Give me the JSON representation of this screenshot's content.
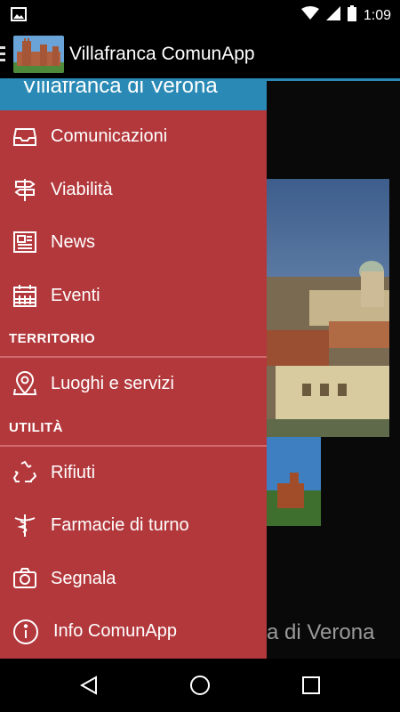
{
  "status_bar": {
    "time": "1:09",
    "icons": [
      "image-icon",
      "wifi-icon",
      "signal-icon",
      "battery-icon"
    ]
  },
  "action_bar": {
    "title": "Villafranca ComunApp",
    "logo": "castle-logo"
  },
  "drawer": {
    "header_title": "Villafranca di Verona",
    "items": [
      {
        "label": "Comunicazioni",
        "icon": "inbox-icon"
      },
      {
        "label": "Viabilità",
        "icon": "signpost-icon"
      },
      {
        "label": "News",
        "icon": "newspaper-icon"
      },
      {
        "label": "Eventi",
        "icon": "calendar-icon"
      }
    ],
    "territorio": {
      "header": "TERRITORIO",
      "items": [
        {
          "label": "Luoghi e servizi",
          "icon": "location-pin-icon"
        }
      ]
    },
    "utilita": {
      "header": "UTILITÀ",
      "items": [
        {
          "label": "Rifiuti",
          "icon": "recycle-icon"
        },
        {
          "label": "Farmacie di turno",
          "icon": "caduceus-icon"
        },
        {
          "label": "Segnala",
          "icon": "camera-icon"
        },
        {
          "label": "Info ComunApp",
          "icon": "info-icon"
        }
      ]
    }
  },
  "content": {
    "caption": "a di Verona"
  },
  "colors": {
    "drawer_bg": "#b3383c",
    "accent_blue": "#2a8ab5"
  }
}
